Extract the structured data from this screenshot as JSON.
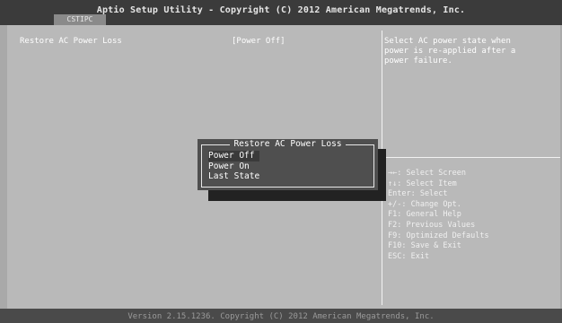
{
  "title": "Aptio Setup Utility - Copyright (C) 2012 American Megatrends, Inc.",
  "tabs": [
    {
      "label": "CSTIPC"
    }
  ],
  "settings": [
    {
      "label": "Restore AC Power Loss",
      "value": "[Power Off]"
    }
  ],
  "help": {
    "description": "Select AC power state when\npower is re-applied after a\npower failure."
  },
  "keys": [
    "→←: Select Screen",
    "↑↓: Select Item",
    "Enter: Select",
    "+/-: Change Opt.",
    "F1: General Help",
    "F2: Previous Values",
    "F9: Optimized Defaults",
    "F10: Save & Exit",
    "ESC: Exit"
  ],
  "popup": {
    "title": "Restore AC Power Loss",
    "options": [
      "Power Off",
      "Power On",
      "Last State"
    ],
    "selected_index": 0
  },
  "footer": "Version 2.15.1236. Copyright (C) 2012 American Megatrends, Inc."
}
